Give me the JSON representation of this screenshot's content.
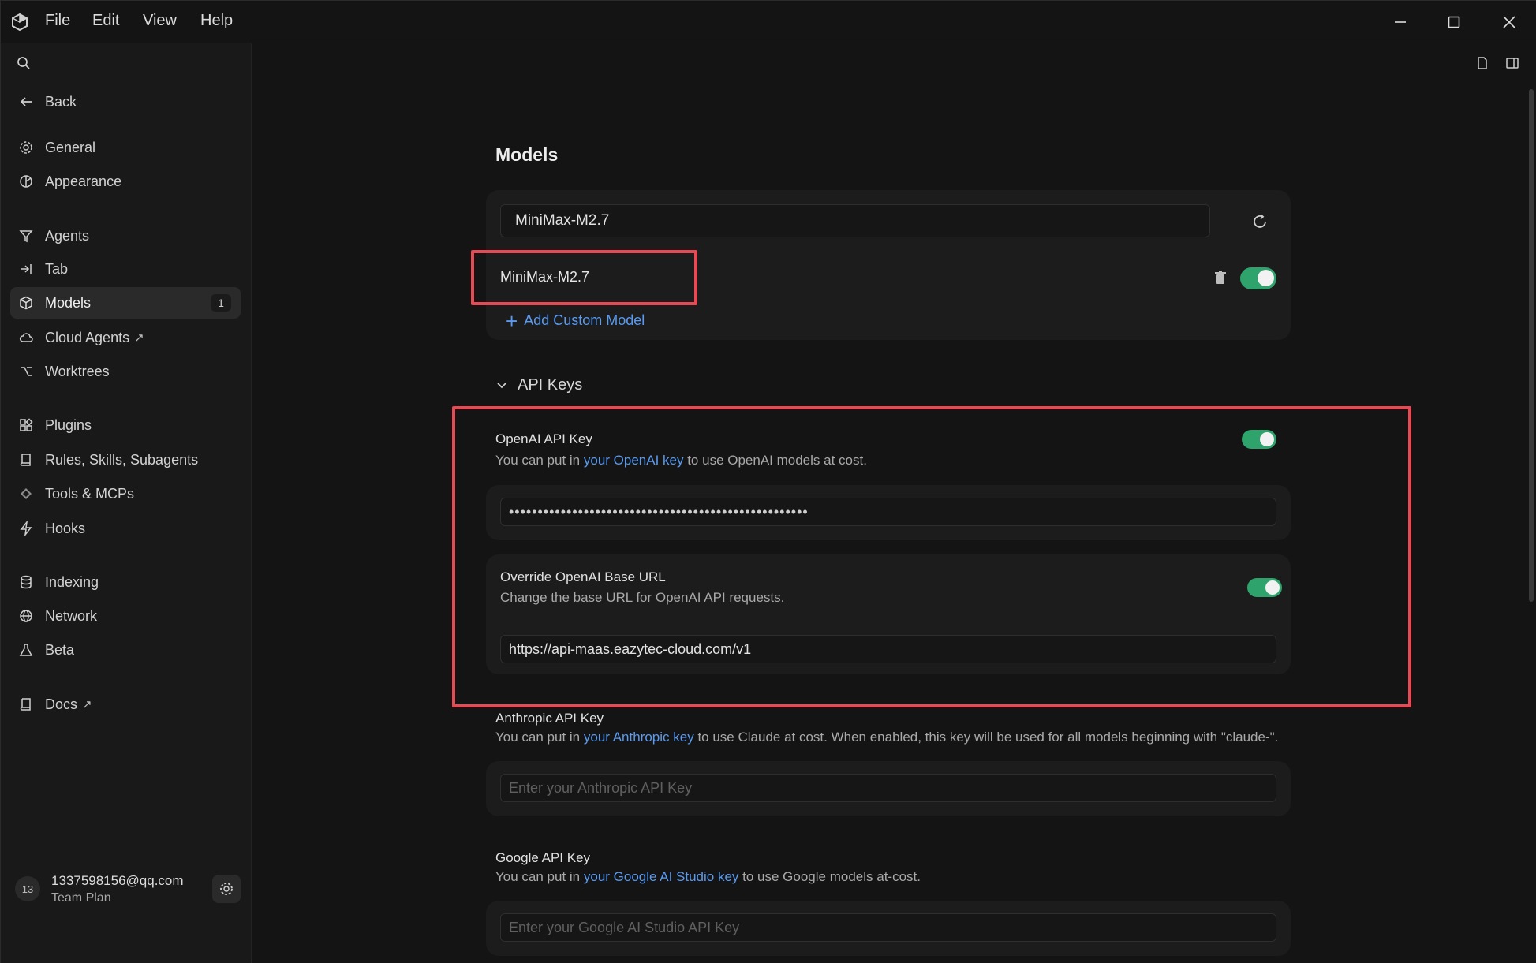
{
  "menu": {
    "file": "File",
    "edit": "Edit",
    "view": "View",
    "help": "Help"
  },
  "sidebar": {
    "back": "Back",
    "items": [
      {
        "label": "General"
      },
      {
        "label": "Appearance"
      },
      {
        "label": "Agents"
      },
      {
        "label": "Tab"
      },
      {
        "label": "Models",
        "badge": "1"
      },
      {
        "label": "Cloud Agents",
        "ext": "↗"
      },
      {
        "label": "Worktrees"
      },
      {
        "label": "Plugins"
      },
      {
        "label": "Rules, Skills, Subagents"
      },
      {
        "label": "Tools & MCPs"
      },
      {
        "label": "Hooks"
      },
      {
        "label": "Indexing"
      },
      {
        "label": "Network"
      },
      {
        "label": "Beta"
      },
      {
        "label": "Docs",
        "ext": "↗"
      }
    ],
    "active": "Models",
    "user": {
      "avatar": "13",
      "email": "1337598156@qq.com",
      "plan": "Team Plan"
    }
  },
  "models": {
    "title": "Models",
    "search_value": "MiniMax-M2.7",
    "model_entry": "MiniMax-M2.7",
    "model_enabled": true,
    "add_custom": "Add Custom Model"
  },
  "api_keys": {
    "heading": "API Keys",
    "openai": {
      "label": "OpenAI API Key",
      "desc_pre": "You can put in ",
      "desc_link": "your OpenAI key",
      "desc_post": " to use OpenAI models at cost.",
      "value": "••••••••••••••••••••••••••••••••••••••••••••••••••••",
      "enabled": true
    },
    "override": {
      "label": "Override OpenAI Base URL",
      "desc": "Change the base URL for OpenAI API requests.",
      "value": "https://api-maas.eazytec-cloud.com/v1",
      "enabled": true
    },
    "anthropic": {
      "label": "Anthropic API Key",
      "desc_pre": "You can put in ",
      "desc_link": "your Anthropic key",
      "desc_post": " to use Claude at cost. When enabled, this key will be used for all models beginning with \"claude-\".",
      "placeholder": "Enter your Anthropic API Key"
    },
    "google": {
      "label": "Google API Key",
      "desc_pre": "You can put in ",
      "desc_link": "your Google AI Studio key",
      "desc_post": " to use Google models at-cost.",
      "placeholder": "Enter your Google AI Studio API Key"
    }
  },
  "colors": {
    "accent_link": "#5a9bf0",
    "toggle_on": "#2ea36b",
    "highlight": "#e64b55"
  }
}
